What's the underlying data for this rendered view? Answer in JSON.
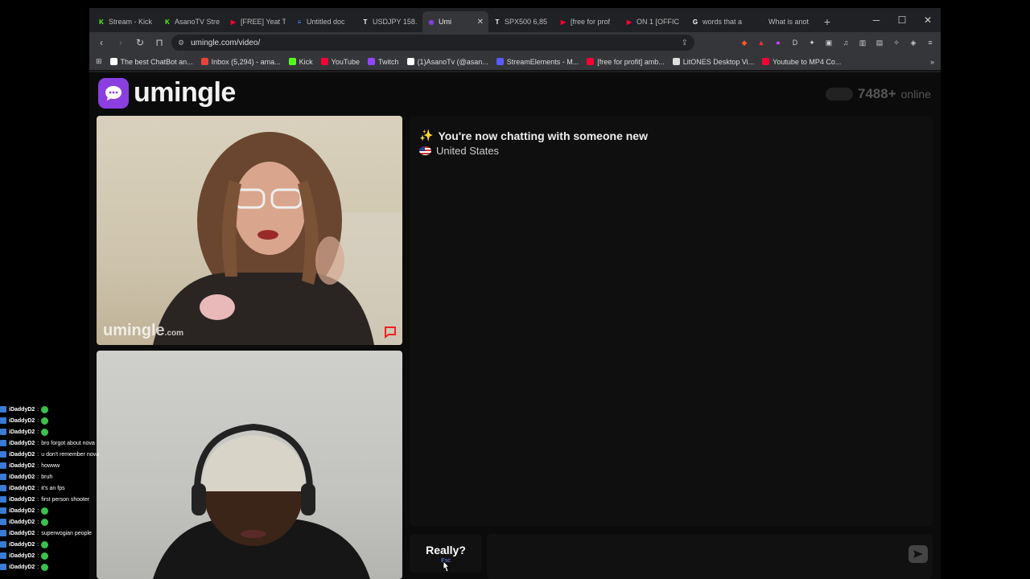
{
  "browser": {
    "tabs": [
      {
        "label": "Stream - Kick",
        "fav_color": "#53fc18",
        "fav_glyph": "K",
        "active": false
      },
      {
        "label": "AsanoTV Stre",
        "fav_color": "#53fc18",
        "fav_glyph": "K",
        "active": false
      },
      {
        "label": "[FREE] Yeat T",
        "fav_color": "#ff0033",
        "fav_glyph": "▶",
        "active": false
      },
      {
        "label": "Untitled doc",
        "fav_color": "#4a8af4",
        "fav_glyph": "≡",
        "active": false
      },
      {
        "label": "USDJPY 158.",
        "fav_color": "#ffffff",
        "fav_glyph": "T",
        "active": false
      },
      {
        "label": "Umi",
        "fav_color": "#8b3fe0",
        "fav_glyph": "◉",
        "active": true
      },
      {
        "label": "SPX500 6,85",
        "fav_color": "#ffffff",
        "fav_glyph": "T",
        "active": false
      },
      {
        "label": "[free for prof",
        "fav_color": "#ff0033",
        "fav_glyph": "▶",
        "active": false
      },
      {
        "label": "ON 1 [OFFIC",
        "fav_color": "#ff0033",
        "fav_glyph": "▶",
        "active": false
      },
      {
        "label": "words that a",
        "fav_color": "#ffffff",
        "fav_glyph": "G",
        "active": false
      },
      {
        "label": "What is anot",
        "fav_color": "#222222",
        "fav_glyph": "h",
        "active": false
      }
    ],
    "url": "umingle.com/video/",
    "bookmarks": [
      {
        "label": "The best ChatBot an...",
        "color": "#ffffff"
      },
      {
        "label": "Inbox (5,294) - ama...",
        "color": "#ea4335"
      },
      {
        "label": "Kick",
        "color": "#53fc18"
      },
      {
        "label": "YouTube",
        "color": "#ff0033"
      },
      {
        "label": "Twitch",
        "color": "#9146ff"
      },
      {
        "label": "(1)AsanoTv (@asan...",
        "color": "#ffffff"
      },
      {
        "label": "StreamElements - M...",
        "color": "#5a5aff"
      },
      {
        "label": "[free for profit] amb...",
        "color": "#ff0033"
      },
      {
        "label": "LitONES Desktop Vi...",
        "color": "#dddddd"
      },
      {
        "label": "Youtube to MP4 Co...",
        "color": "#ff0033"
      }
    ]
  },
  "site": {
    "brand": "umingle",
    "online_count": "7488+",
    "online_label": "online",
    "watermark": "umingle",
    "watermark_suffix": ".com",
    "chat_status": "You're now chatting with someone new",
    "chat_country": "United States",
    "esc_label": "Really?",
    "esc_hint": "Esc",
    "accent_color": "#8b3fe0"
  },
  "stream_chat": [
    {
      "user": "iDaddyD2",
      "msg": "",
      "emote": true
    },
    {
      "user": "iDaddyD2",
      "msg": "",
      "emote": true
    },
    {
      "user": "iDaddyD2",
      "msg": "",
      "emote": true
    },
    {
      "user": "iDaddyD2",
      "msg": "bro forgot about nova",
      "emote": false
    },
    {
      "user": "iDaddyD2",
      "msg": "u don't remember nova",
      "emote": false
    },
    {
      "user": "iDaddyD2",
      "msg": "howww",
      "emote": false
    },
    {
      "user": "iDaddyD2",
      "msg": "bruh",
      "emote": false
    },
    {
      "user": "iDaddyD2",
      "msg": "it's an fps",
      "emote": false
    },
    {
      "user": "iDaddyD2",
      "msg": "first person shooter",
      "emote": false
    },
    {
      "user": "iDaddyD2",
      "msg": "",
      "emote": true
    },
    {
      "user": "iDaddyD2",
      "msg": "",
      "emote": true
    },
    {
      "user": "iDaddyD2",
      "msg": "superwogian people",
      "emote": false
    },
    {
      "user": "iDaddyD2",
      "msg": "",
      "emote": true
    },
    {
      "user": "iDaddyD2",
      "msg": "",
      "emote": true
    },
    {
      "user": "iDaddyD2",
      "msg": "",
      "emote": true
    }
  ]
}
